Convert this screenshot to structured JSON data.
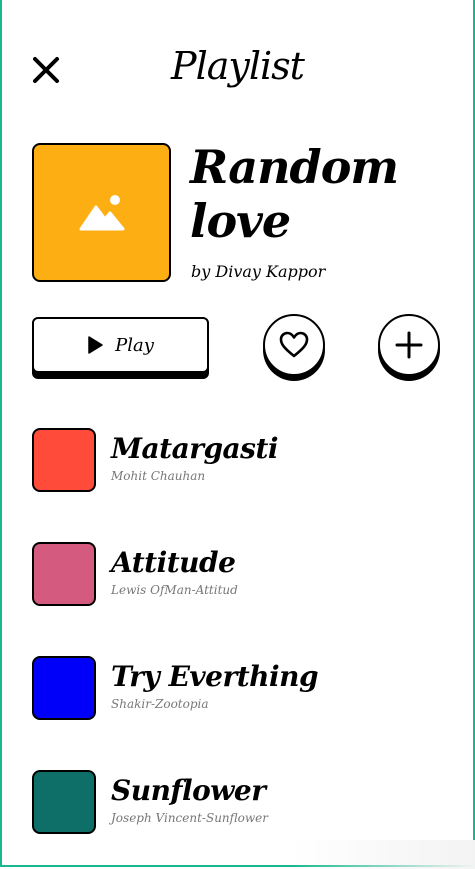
{
  "header": {
    "title": "Playlist",
    "close_icon": "close-icon"
  },
  "album": {
    "title": "Random love",
    "author": "by Divay Kappor",
    "cover_color": "#fdae13",
    "cover_icon": "image-icon"
  },
  "actions": {
    "play_label": "Play",
    "play_icon": "play-icon",
    "like_icon": "heart-icon",
    "add_icon": "plus-icon"
  },
  "tracks": [
    {
      "title": "Matargasti",
      "artist": "Mohit Chauhan",
      "color": "#ff4c3a"
    },
    {
      "title": "Attitude",
      "artist": "Lewis OfMan-Attitud",
      "color": "#d45a7f"
    },
    {
      "title": "Try Everthing",
      "artist": "Shakir-Zootopia",
      "color": "#0000fa"
    },
    {
      "title": "Sunflower",
      "artist": "Joseph Vincent-Sunflower",
      "color": "#0e6f69"
    }
  ],
  "colors": {
    "frame": "#17b88f",
    "border": "#000000",
    "background": "#ffffff"
  }
}
